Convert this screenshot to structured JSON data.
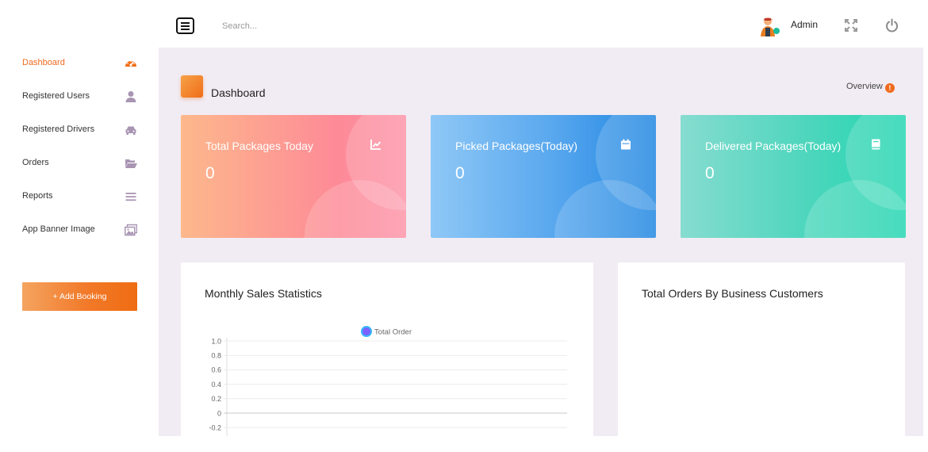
{
  "header": {
    "search_placeholder": "Search...",
    "user_name": "Admin",
    "icons": [
      "menu-icon",
      "avatar",
      "fullscreen-icon",
      "power-icon"
    ]
  },
  "sidebar": {
    "items": [
      {
        "label": "Dashboard",
        "icon": "dashboard-gauge-icon",
        "active": true
      },
      {
        "label": "Registered Users",
        "icon": "user-icon",
        "active": false
      },
      {
        "label": "Registered Drivers",
        "icon": "car-icon",
        "active": false
      },
      {
        "label": "Orders",
        "icon": "folder-open-icon",
        "active": false
      },
      {
        "label": "Reports",
        "icon": "list-icon",
        "active": false
      },
      {
        "label": "App Banner Image",
        "icon": "images-icon",
        "active": false
      }
    ],
    "add_booking_label": "+ Add Booking"
  },
  "main": {
    "page_title": "Dashboard",
    "overview_label": "Overview",
    "overview_badge": "!",
    "cards": [
      {
        "title": "Total Packages Today",
        "value": "0",
        "icon": "line-chart-icon"
      },
      {
        "title": "Picked Packages(Today)",
        "value": "0",
        "icon": "calendar-icon"
      },
      {
        "title": "Delivered Packages(Today)",
        "value": "0",
        "icon": "book-icon"
      }
    ],
    "panels": {
      "monthly_sales_title": "Monthly Sales Statistics",
      "business_orders_title": "Total Orders By Business Customers"
    }
  },
  "colors": {
    "accent": "#f06a20",
    "main_bg": "#f1ecf3"
  },
  "chart_data": {
    "type": "line",
    "title": "",
    "series": [
      {
        "name": "Total Order",
        "values": []
      }
    ],
    "ylim": [
      -0.2,
      1.0
    ],
    "yticks": [
      "1.0",
      "0.8",
      "0.6",
      "0.4",
      "0.2",
      "0",
      "-0.2"
    ],
    "grid": true,
    "legend": "top"
  }
}
